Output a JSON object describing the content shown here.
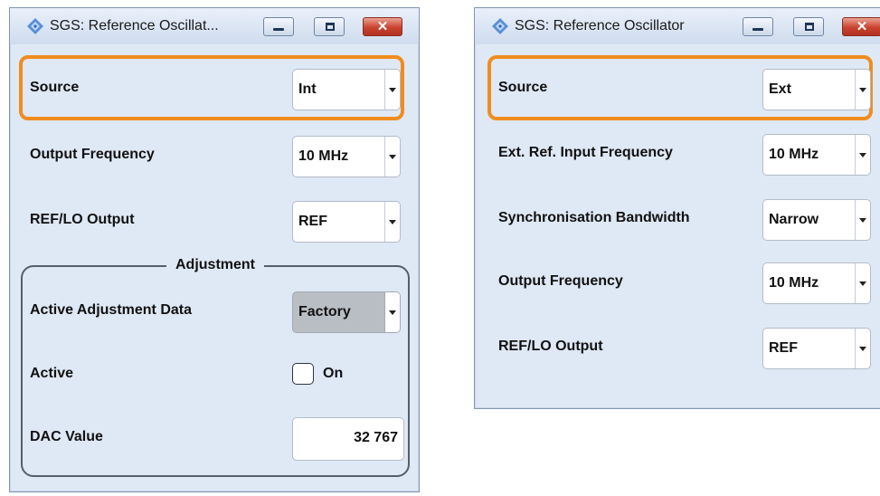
{
  "left_window": {
    "title": "SGS: Reference Oscillat...",
    "source": {
      "label": "Source",
      "value": "Int"
    },
    "output_frequency": {
      "label": "Output Frequency",
      "value": "10 MHz"
    },
    "ref_lo_output": {
      "label": "REF/LO Output",
      "value": "REF"
    },
    "adjustment": {
      "title": "Adjustment",
      "active_adjustment_data": {
        "label": "Active Adjustment Data",
        "value": "Factory"
      },
      "active": {
        "label": "Active",
        "checkbox_label": "On",
        "checked": false
      },
      "dac_value": {
        "label": "DAC Value",
        "value": "32 767"
      }
    }
  },
  "right_window": {
    "title": "SGS: Reference Oscillator",
    "source": {
      "label": "Source",
      "value": "Ext"
    },
    "ext_ref_input_frequency": {
      "label": "Ext. Ref. Input Frequency",
      "value": "10 MHz"
    },
    "sync_bandwidth": {
      "label": "Synchronisation Bandwidth",
      "value": "Narrow"
    },
    "output_frequency": {
      "label": "Output Frequency",
      "value": "10 MHz"
    },
    "ref_lo_output": {
      "label": "REF/LO Output",
      "value": "REF"
    }
  },
  "icons": {
    "app": "diamond-logo-icon",
    "minimize": "minimize-icon",
    "maximize": "maximize-icon",
    "close": "close-icon"
  },
  "colors": {
    "highlight": "#f08c1e",
    "window_bg": "#dfe8f5",
    "close_button": "#c9432f"
  }
}
